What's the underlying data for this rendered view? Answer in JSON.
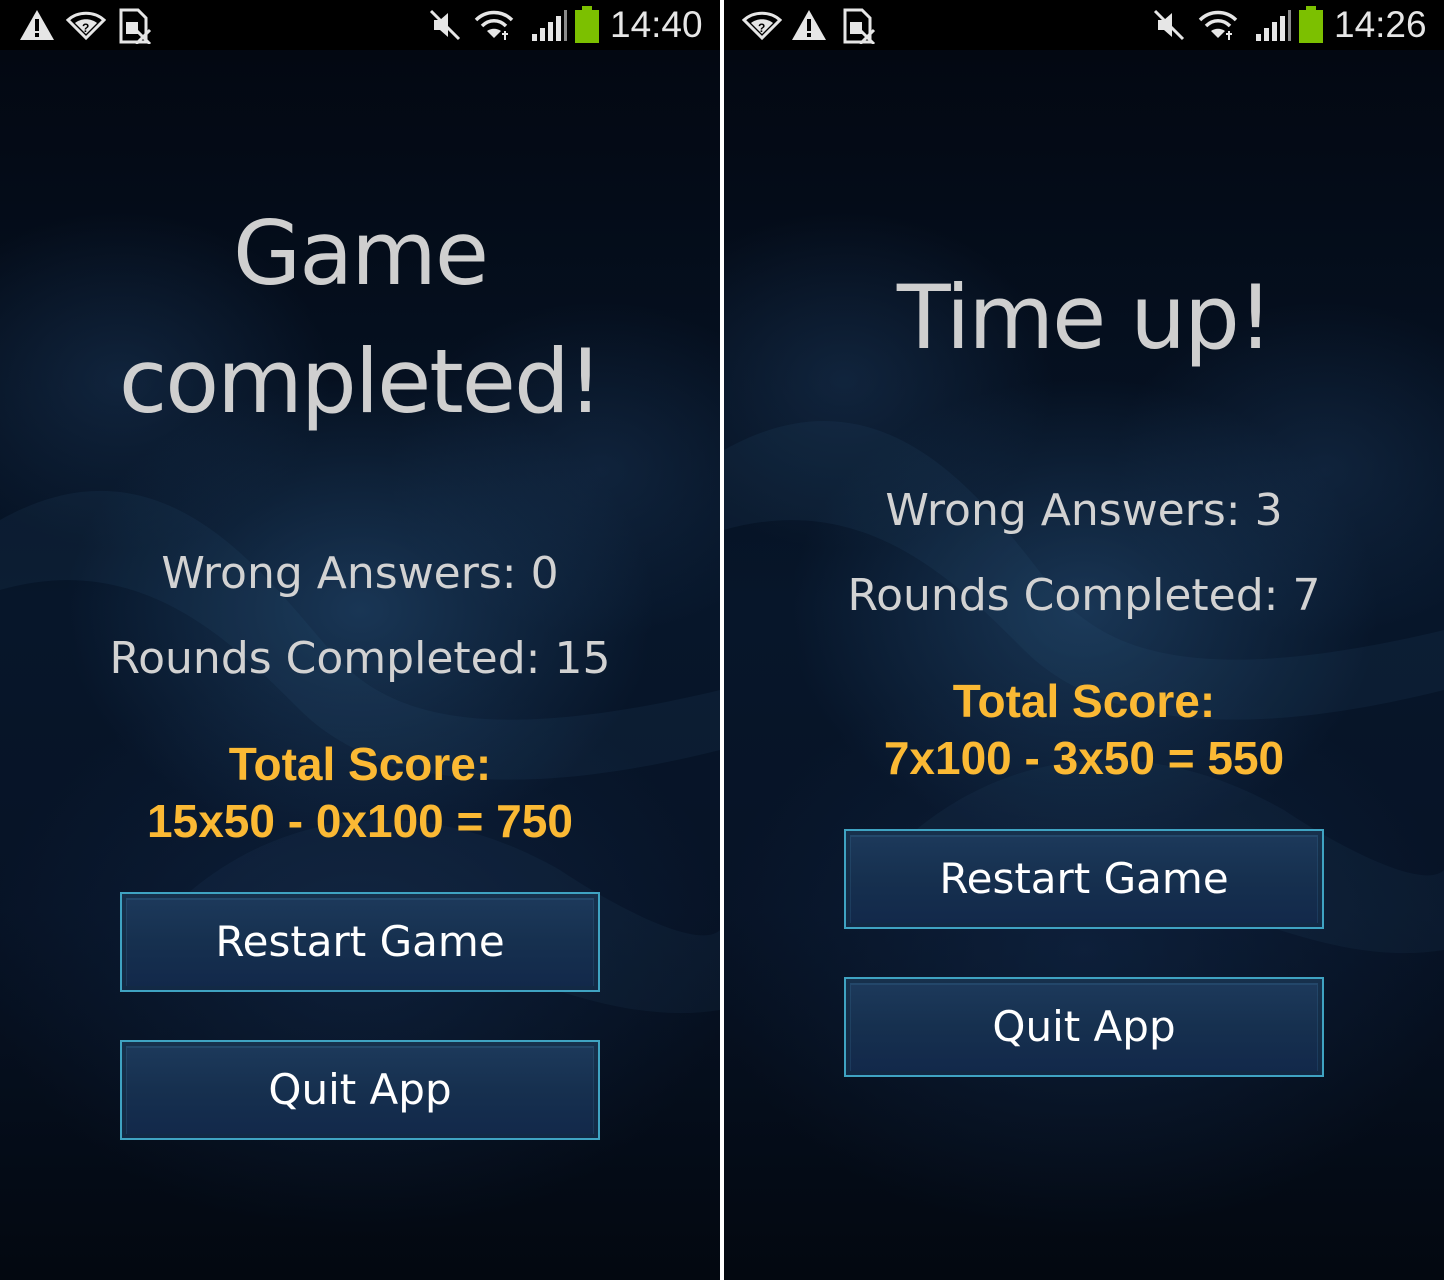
{
  "screens": [
    {
      "status_bar": {
        "left_icons": [
          "warning-icon",
          "wifi-question-icon",
          "no-sim-icon"
        ],
        "right_icons": [
          "mute-icon",
          "wifi-icon",
          "signal-icon",
          "battery-icon"
        ],
        "time": "14:40"
      },
      "headline_lines": [
        "Game",
        "completed!"
      ],
      "stats": {
        "wrong_answers": "Wrong Answers: 0",
        "rounds_completed": "Rounds Completed: 15"
      },
      "score": {
        "label": "Total Score:",
        "formula": "15x50 - 0x100 = 750"
      },
      "buttons": {
        "restart": "Restart Game",
        "quit": "Quit App"
      }
    },
    {
      "status_bar": {
        "left_icons": [
          "wifi-question-icon",
          "warning-icon",
          "no-sim-icon"
        ],
        "right_icons": [
          "mute-icon",
          "wifi-icon",
          "signal-icon",
          "battery-icon"
        ],
        "time": "14:26"
      },
      "headline_lines": [
        "Time up!"
      ],
      "stats": {
        "wrong_answers": "Wrong Answers: 3",
        "rounds_completed": "Rounds Completed: 7"
      },
      "score": {
        "label": "Total Score:",
        "formula": "7x100 - 3x50 = 550"
      },
      "buttons": {
        "restart": "Restart Game",
        "quit": "Quit App"
      }
    }
  ],
  "colors": {
    "score_accent": "#fbb934",
    "button_border": "#3fa3c2",
    "button_fill": "#16304f",
    "battery": "#7cc000",
    "background": "#050c18"
  }
}
